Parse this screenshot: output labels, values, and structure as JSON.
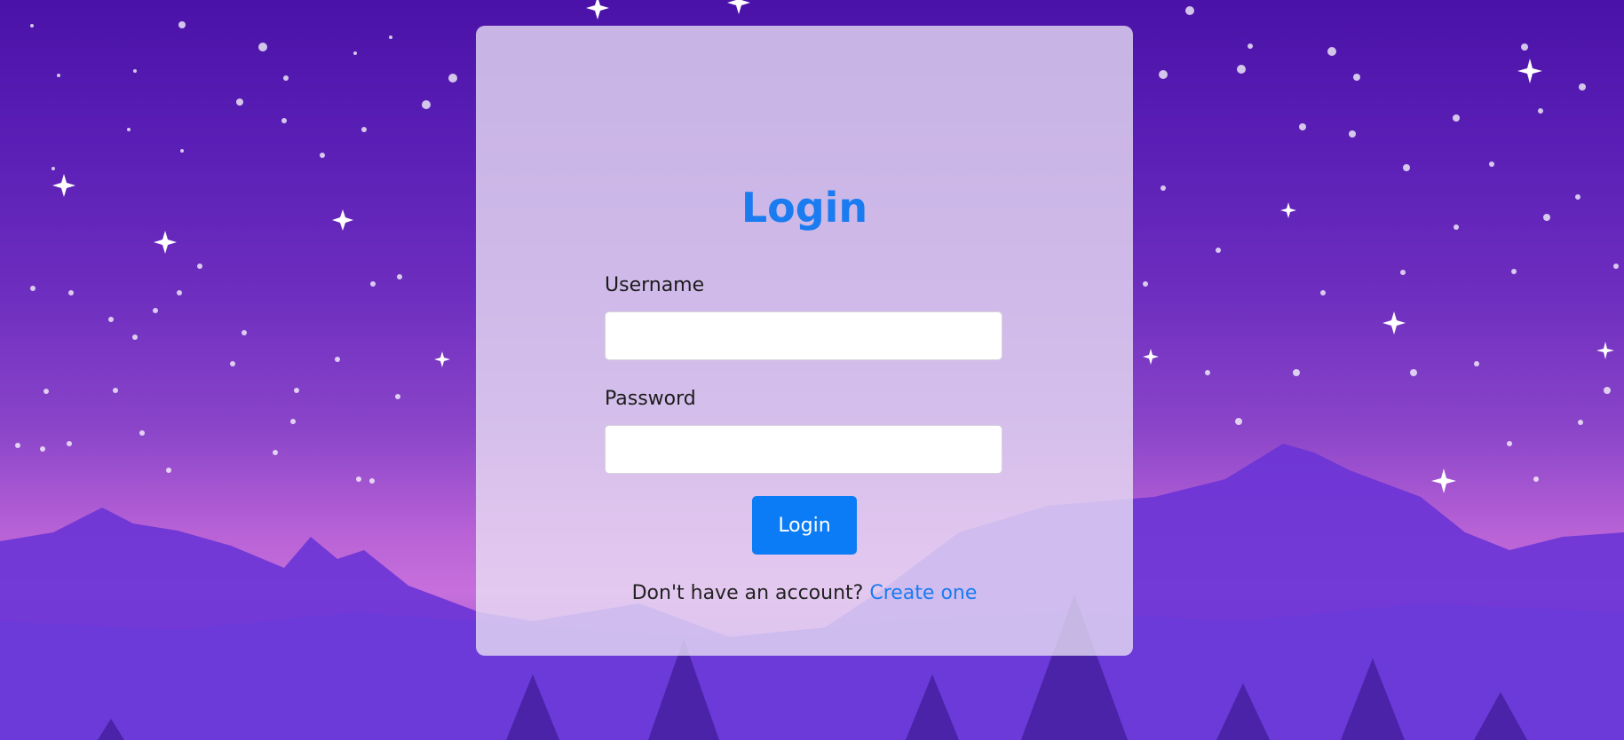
{
  "login": {
    "title": "Login",
    "username_label": "Username",
    "username_value": "",
    "password_label": "Password",
    "password_value": "",
    "submit_label": "Login",
    "footer_text": "Don't have an account?",
    "footer_link": "Create one"
  },
  "colors": {
    "accent": "#1a7cf0",
    "button": "#0b7cf5",
    "sky_top": "#4a12a8",
    "horizon": "#c76fdc"
  }
}
